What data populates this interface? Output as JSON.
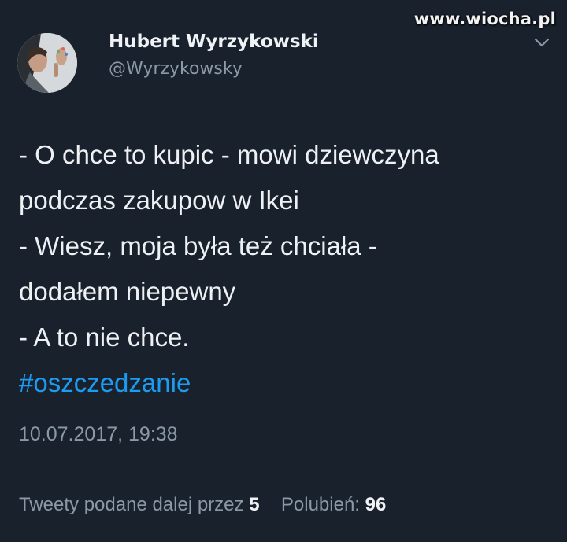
{
  "watermark": "www.wiocha.pl",
  "tweet": {
    "author_name": "Hubert Wyrzykowski",
    "author_handle": "@Wyrzykowsky",
    "text_lines": [
      "- O chce to kupic - mowi dziewczyna",
      "podczas zakupow w Ikei",
      "- Wiesz, moja była też chciała -",
      "dodałem niepewny",
      "- A to nie chce."
    ],
    "hashtag": "#oszczedzanie",
    "timestamp": "10.07.2017, 19:38",
    "retweets_label": "Tweety podane dalej przez",
    "retweets_count": "5",
    "likes_label": "Polubień:",
    "likes_count": "96"
  },
  "icons": {
    "avatar": "user-avatar-photo",
    "more": "chevron-down-icon"
  },
  "colors": {
    "background": "#19212d",
    "link": "#1d9bf0",
    "muted_text": "#8b99a6",
    "primary_text": "#eef1f4"
  }
}
